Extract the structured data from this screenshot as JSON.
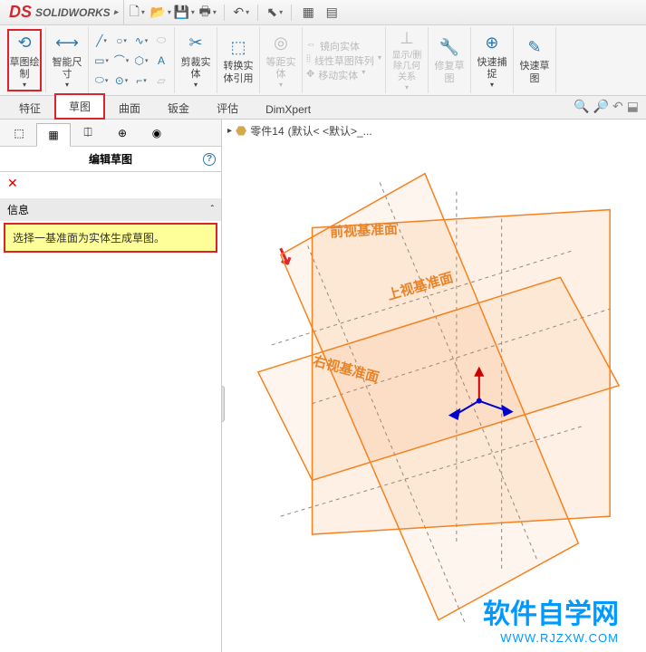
{
  "app": {
    "name": "SOLIDWORKS"
  },
  "ribbon": {
    "sketch_btn": "草图绘制",
    "smart_dim": "智能尺寸",
    "trim": "剪裁实体",
    "convert": "转换实体引用",
    "offset": "等距实体",
    "mirror": "镜向实体",
    "pattern": "线性草图阵列",
    "move": "移动实体",
    "display": "显示/删除几何关系",
    "repair": "修复草图",
    "quick_snap": "快速捕捉",
    "quick_sketch": "快速草图"
  },
  "tabs": [
    "特征",
    "草图",
    "曲面",
    "钣金",
    "评估",
    "DimXpert"
  ],
  "left": {
    "title": "编辑草图",
    "info_head": "信息",
    "info_msg": "选择一基准面为实体生成草图。"
  },
  "breadcrumb": {
    "part": "零件14",
    "config": "(默认< <默认>_..."
  },
  "planes": {
    "front": "前视基准面",
    "top": "上视基准面",
    "right": "右视基准面"
  },
  "watermark": {
    "cn": "软件自学网",
    "url": "WWW.RJZXW.COM"
  }
}
